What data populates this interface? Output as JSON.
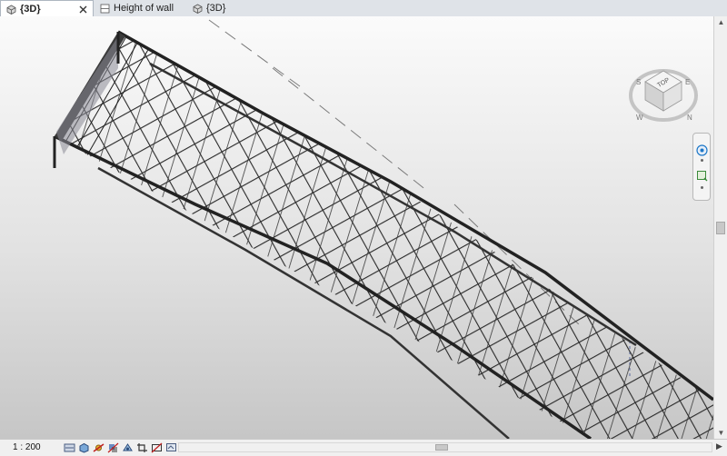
{
  "tabs": [
    {
      "label": "{3D}",
      "active": true,
      "icon": "3d-view-icon",
      "closable": true
    },
    {
      "label": "Height of wall",
      "active": false,
      "icon": "section-view-icon",
      "closable": false
    },
    {
      "label": "{3D}",
      "active": false,
      "icon": "3d-view-icon",
      "closable": false
    }
  ],
  "viewcube": {
    "face_label": "TOP",
    "compass": [
      "S",
      "E",
      "N",
      "W"
    ]
  },
  "statusbar": {
    "scale": "1 : 200"
  },
  "icons": {
    "view_controls": [
      "detail-level-icon",
      "visual-style-icon",
      "sun-path-icon",
      "shadows-icon",
      "render-icon",
      "crop-view-icon",
      "show-crop-icon",
      "temporary-hide-icon"
    ],
    "navbar": [
      "steering-wheel-icon",
      "zoom-icon"
    ]
  },
  "colors": {
    "accent": "#1e78c8",
    "tab_bar": "#dfe3e8",
    "viewport_top": "#fbfbfb",
    "viewport_bottom": "#c6c6c6"
  }
}
